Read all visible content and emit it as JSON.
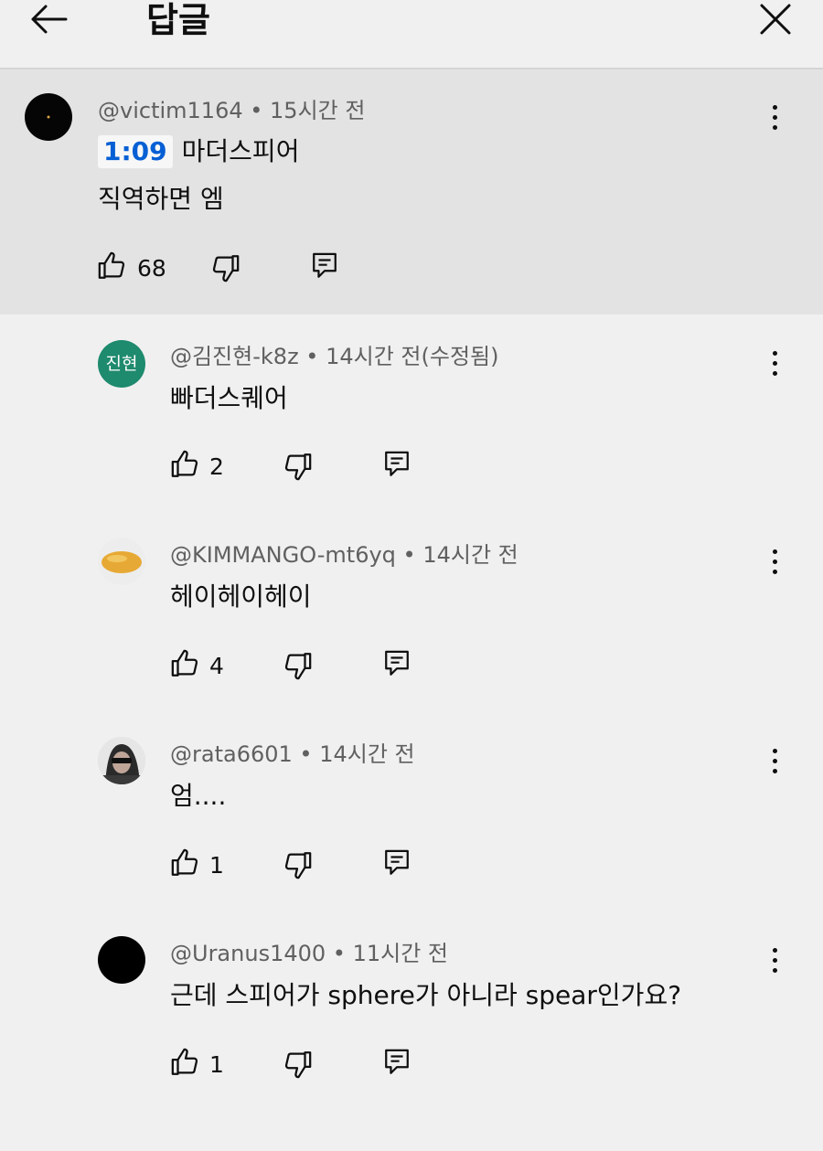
{
  "header": {
    "title": "답글",
    "back_icon": "arrow-left-icon",
    "close_icon": "close-icon"
  },
  "parent": {
    "author": "@victim1164",
    "time": "15시간 전",
    "timestamp_link": "1:09",
    "line1_rest": "마더스피어",
    "line2": "직역하면 엠",
    "likes": "68"
  },
  "replies": [
    {
      "author": "@김진현-k8z",
      "time": "14시간 전(수정됨)",
      "avatar_text": "진현",
      "avatar_color": "#1e8a6e",
      "text": "빠더스퀘어",
      "likes": "2"
    },
    {
      "author": "@KIMMANGO-mt6yq",
      "time": "14시간 전",
      "text": "헤이헤이헤이",
      "likes": "4"
    },
    {
      "author": "@rata6601",
      "time": "14시간 전",
      "text": "엄....",
      "likes": "1"
    },
    {
      "author": "@Uranus1400",
      "time": "11시간 전",
      "text": "근데 스피어가 sphere가 아니라 spear인가요?",
      "likes": "1"
    }
  ],
  "separator": " • ",
  "colors": {
    "background": "#f0f0f0",
    "highlight": "#e3e3e3",
    "link": "#065fd4",
    "meta": "#606060"
  }
}
